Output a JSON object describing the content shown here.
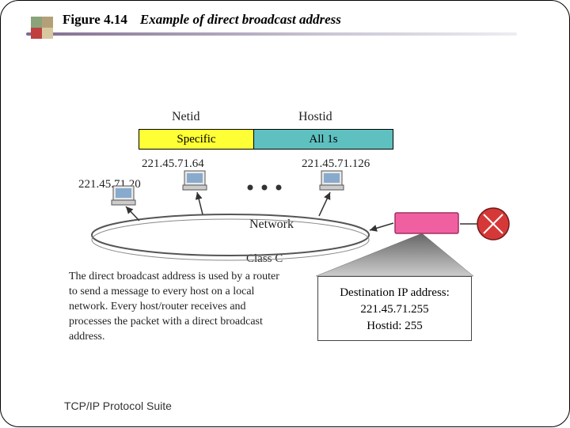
{
  "header": {
    "figure_label": "Figure 4.14",
    "figure_title": "Example of direct broadcast address"
  },
  "columns": {
    "netid": "Netid",
    "hostid": "Hostid"
  },
  "fields": {
    "specific": "Specific",
    "all1s": "All 1s"
  },
  "ips": {
    "host64": "221.45.71.64",
    "host20": "221.45.71.20",
    "host126": "221.45.71.126"
  },
  "network": {
    "label": "Network",
    "class": "Class C"
  },
  "explanation": "The direct broadcast address is used by a router to send a message to every host on a local network. Every host/router receives and processes the packet with a direct broadcast address.",
  "destination": {
    "line1": "Destination IP address:",
    "line2": "221.45.71.255",
    "line3": "Hostid: 255"
  },
  "footer": "TCP/IP Protocol Suite"
}
